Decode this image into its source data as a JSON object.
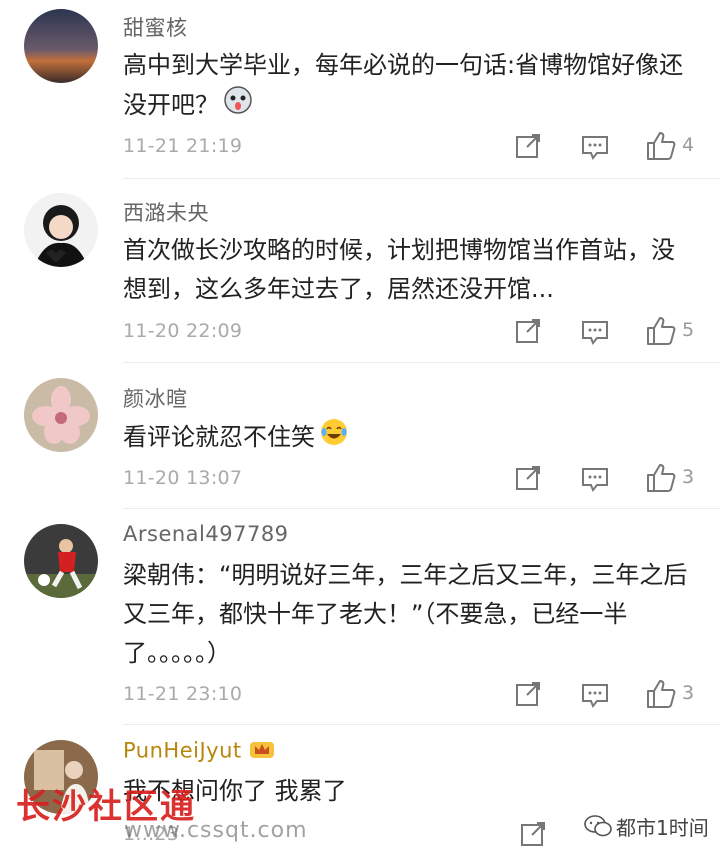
{
  "comments": [
    {
      "username": "甜蜜核",
      "text": "高中到大学毕业，每年必说的一句话:省博物馆好像还没开吧？",
      "time": "11-21 21:19",
      "likes": "4",
      "avatar_icon": "sunset-avatar-icon"
    },
    {
      "username": "西潞未央",
      "text": "首次做长沙攻略的时候，计划把博物馆当作首站，没想到，这么多年过去了，居然还没开馆...",
      "time": "11-20 22:09",
      "likes": "5",
      "avatar_icon": "doll-avatar-icon"
    },
    {
      "username": "颜冰暄",
      "text": "看评论就忍不住笑",
      "time": "11-20 13:07",
      "likes": "3",
      "avatar_icon": "flower-avatar-icon"
    },
    {
      "username": "Arsenal497789",
      "text": "梁朝伟：“明明说好三年，三年之后又三年，三年之后又三年，都快十年了老大！”（不要急，已经一半了。。。。。）",
      "time": "11-21 23:10",
      "likes": "3",
      "avatar_icon": "soccer-avatar-icon"
    },
    {
      "username": "PunHeiJyut",
      "text": "我不想问你了 我累了",
      "time": "1...23",
      "likes": "",
      "avatar_icon": "photo-avatar-icon"
    }
  ],
  "watermark": {
    "left_text": "长沙社区通",
    "url": "www.cssqt.com",
    "right_text": "都市1时间"
  },
  "colors": {
    "username": "#666666",
    "vip_username": "#b8860b",
    "watermark_red": "#d9211f"
  }
}
